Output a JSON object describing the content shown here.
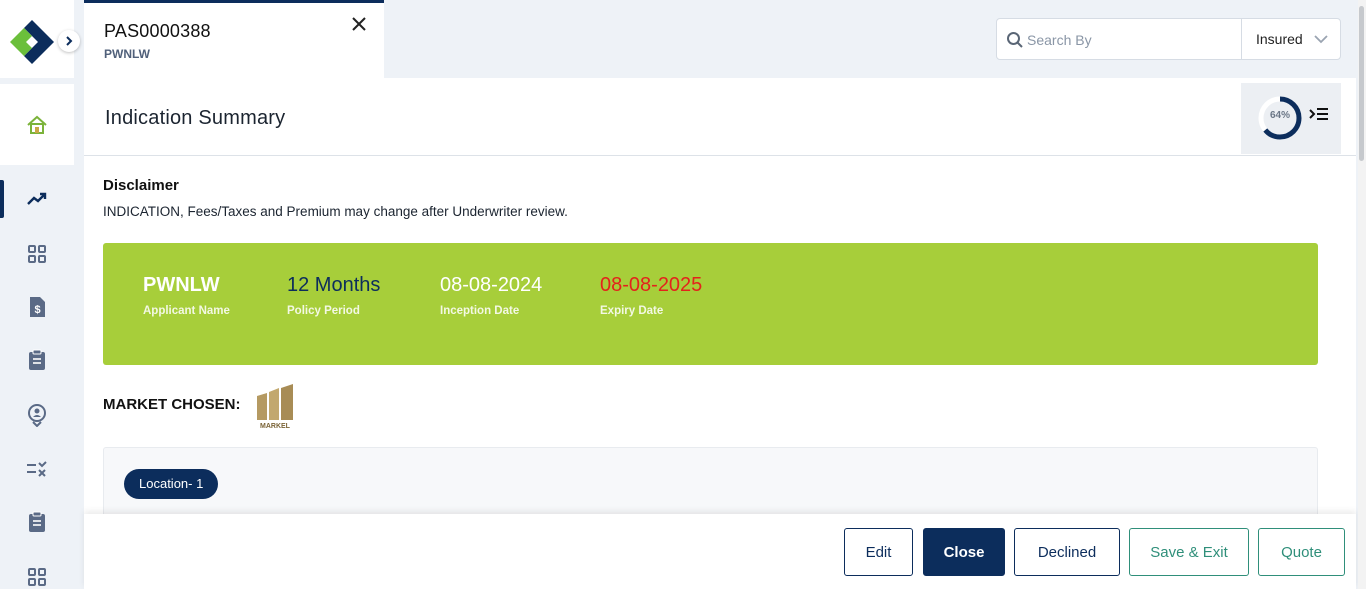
{
  "sidebar": {
    "icons": [
      "app-logo",
      "expand-chevron-icon",
      "home-icon",
      "trending-icon",
      "grid-icon",
      "invoice-icon",
      "clipboard-icon",
      "location-user-icon",
      "checklist-icon",
      "clipboard-icon",
      "grid-icon"
    ]
  },
  "tab": {
    "title": "PAS0000388",
    "subtitle": "PWNLW"
  },
  "search": {
    "placeholder": "Search By",
    "filter_value": "Insured"
  },
  "page": {
    "title": "Indication Summary",
    "progress_percent": 64,
    "progress_label": "64%"
  },
  "disclaimer": {
    "title": "Disclaimer",
    "text": "INDICATION, Fees/Taxes and Premium may change after Underwriter review."
  },
  "summary": {
    "applicant_name": "PWNLW",
    "applicant_name_label": "Applicant Name",
    "policy_period": "12 Months",
    "policy_period_label": "Policy Period",
    "inception_date": "08-08-2024",
    "inception_date_label": "Inception Date",
    "expiry_date": "08-08-2025",
    "expiry_date_label": "Expiry Date"
  },
  "market": {
    "label": "MARKET CHOSEN:",
    "logo_text": "MARKEL"
  },
  "location": {
    "pill": "Location- 1"
  },
  "footer": {
    "edit": "Edit",
    "close": "Close",
    "declined": "Declined",
    "save_exit": "Save & Exit",
    "quote": "Quote"
  },
  "colors": {
    "primary": "#0c2d5c",
    "banner": "#a7ce3a",
    "expiry": "#e3231b",
    "teal": "#2f8f7a",
    "logo_green": "#6bbf3b"
  }
}
